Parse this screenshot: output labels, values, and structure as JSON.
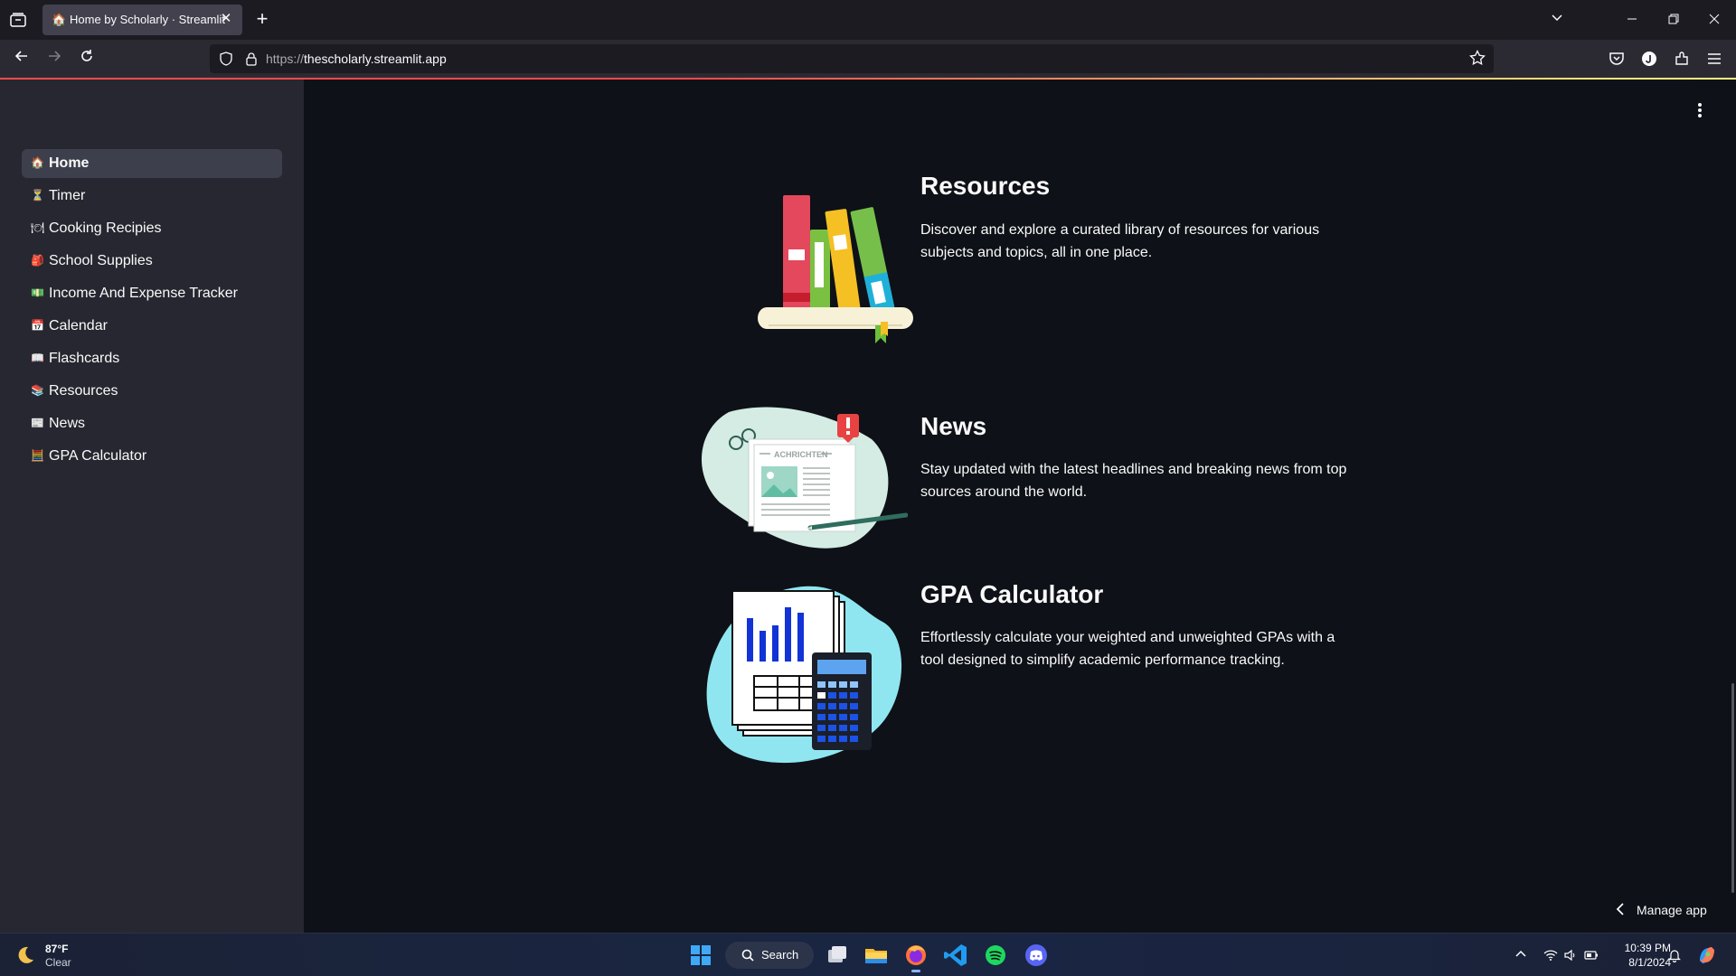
{
  "browser": {
    "tab": {
      "favicon": "🏠",
      "title": "Home by Scholarly · Streamlit",
      "close": "✕"
    },
    "new_tab": "+",
    "url_protocol": "https://",
    "url_host": "thescholarly.streamlit.app"
  },
  "sidebar": {
    "items": [
      {
        "emoji": "🏠",
        "label": "Home",
        "active": true
      },
      {
        "emoji": "⏳",
        "label": "Timer"
      },
      {
        "emoji": "🍽",
        "label": "Cooking Recipies"
      },
      {
        "emoji": "🎒",
        "label": "School Supplies"
      },
      {
        "emoji": "💵",
        "label": "Income And Expense Tracker"
      },
      {
        "emoji": "📅",
        "label": "Calendar"
      },
      {
        "emoji": "📖",
        "label": "Flashcards"
      },
      {
        "emoji": "📚",
        "label": "Resources"
      },
      {
        "emoji": "📰",
        "label": "News"
      },
      {
        "emoji": "🧮",
        "label": "GPA Calculator"
      }
    ]
  },
  "main": {
    "sections": [
      {
        "title": "Resources",
        "description": "Discover and explore a curated library of resources for various subjects and topics, all in one place.",
        "image_icon": "books-illustration"
      },
      {
        "title": "News",
        "description": "Stay updated with the latest headlines and breaking news from top sources around the world.",
        "image_icon": "newspaper-illustration",
        "image_text": "ACHRICHTEN"
      },
      {
        "title": "GPA Calculator",
        "description": "Effortlessly calculate your weighted and unweighted GPAs with a tool designed to simplify academic performance tracking.",
        "image_icon": "calculator-chart-illustration"
      }
    ],
    "manage_app": "Manage app"
  },
  "taskbar": {
    "weather_temp": "87°F",
    "weather_condition": "Clear",
    "search_label": "Search",
    "time": "10:39 PM",
    "date": "8/1/2024"
  }
}
